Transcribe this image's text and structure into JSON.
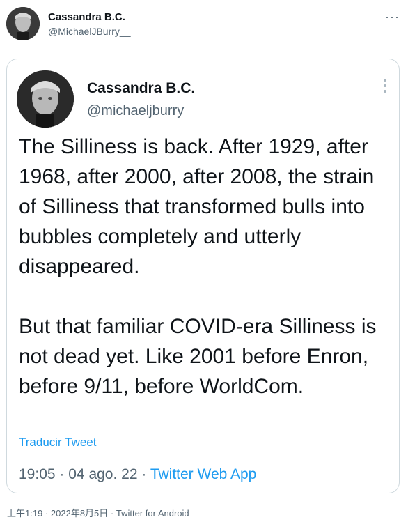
{
  "outer_tweet": {
    "name": "Cassandra B.C.",
    "handle": "@MichaelJBurry__",
    "more_label": "···",
    "footer": {
      "time": "上午1:19",
      "date": "2022年8月5日",
      "source": "Twitter for Android",
      "separator": "·"
    }
  },
  "quoted_tweet": {
    "name": "Cassandra B.C.",
    "handle": "@michaeljburry",
    "text": "The Silliness is back. After 1929, after 1968, after 2000, after 2008, the strain of Silliness that transformed bulls into bubbles completely and utterly disappeared.\n\nBut that familiar COVID-era Silliness is not dead yet. Like 2001 before Enron, before 9/11, before WorldCom.",
    "translate_label": "Traducir Tweet",
    "time": "19:05",
    "date": "04 ago. 22",
    "source": "Twitter Web App",
    "separator": "·"
  },
  "colors": {
    "link": "#1d9bf0",
    "secondary_text": "#536471",
    "border": "#cfd9de"
  }
}
